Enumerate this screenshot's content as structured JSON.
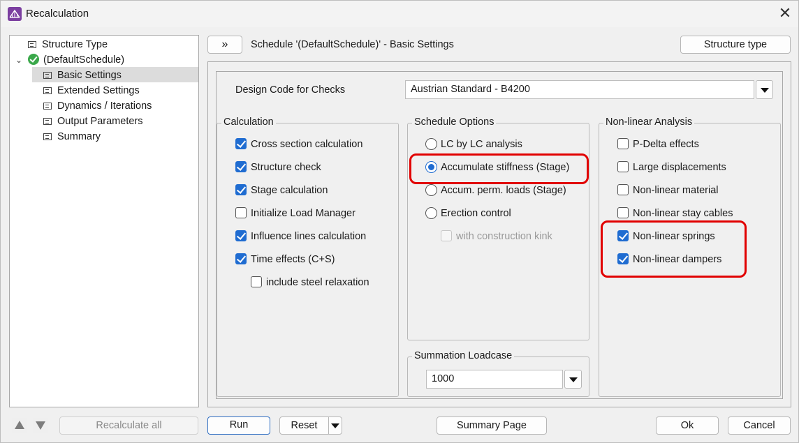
{
  "window": {
    "title": "Recalculation",
    "close_glyph": "✕"
  },
  "tree": {
    "items": [
      {
        "label": "Structure Type"
      },
      {
        "label": "(DefaultSchedule)"
      },
      {
        "label": "Basic Settings"
      },
      {
        "label": "Extended Settings"
      },
      {
        "label": "Dynamics / Iterations"
      },
      {
        "label": "Output Parameters"
      },
      {
        "label": "Summary"
      }
    ],
    "expand_glyph": "⌄"
  },
  "header": {
    "toggle_label": "»",
    "title": "Schedule '(DefaultSchedule)' - Basic Settings",
    "structure_type_button": "Structure type"
  },
  "design_code": {
    "label": "Design Code for Checks",
    "value": "Austrian Standard - B4200"
  },
  "calculation": {
    "title": "Calculation",
    "items": [
      {
        "label": "Cross section calculation",
        "checked": true
      },
      {
        "label": "Structure check",
        "checked": true
      },
      {
        "label": "Stage calculation",
        "checked": true
      },
      {
        "label": "Initialize Load Manager",
        "checked": false
      },
      {
        "label": "Influence lines calculation",
        "checked": true
      },
      {
        "label": "Time effects (C+S)",
        "checked": true
      },
      {
        "label": "include steel relaxation",
        "checked": false
      }
    ]
  },
  "schedule_options": {
    "title": "Schedule Options",
    "radios": [
      {
        "label": "LC by LC analysis",
        "selected": false
      },
      {
        "label": "Accumulate stiffness (Stage)",
        "selected": true
      },
      {
        "label": "Accum. perm. loads (Stage)",
        "selected": false
      },
      {
        "label": "Erection control",
        "selected": false
      }
    ],
    "sub_option": {
      "label": "with construction kink",
      "checked": false,
      "enabled": false
    }
  },
  "summation": {
    "title": "Summation Loadcase",
    "value": "1000"
  },
  "nonlinear": {
    "title": "Non-linear Analysis",
    "items": [
      {
        "label": "P-Delta effects",
        "checked": false
      },
      {
        "label": "Large displacements",
        "checked": false
      },
      {
        "label": "Non-linear material",
        "checked": false
      },
      {
        "label": "Non-linear stay cables",
        "checked": false
      },
      {
        "label": "Non-linear springs",
        "checked": true
      },
      {
        "label": "Non-linear dampers",
        "checked": true
      }
    ]
  },
  "footer": {
    "recalculate_all": "Recalculate all",
    "run": "Run",
    "reset": "Reset",
    "summary_page": "Summary Page",
    "ok": "Ok",
    "cancel": "Cancel"
  },
  "colors": {
    "accent": "#1f6cd1",
    "highlight": "#e10000",
    "status_ok": "#3aa84a"
  }
}
